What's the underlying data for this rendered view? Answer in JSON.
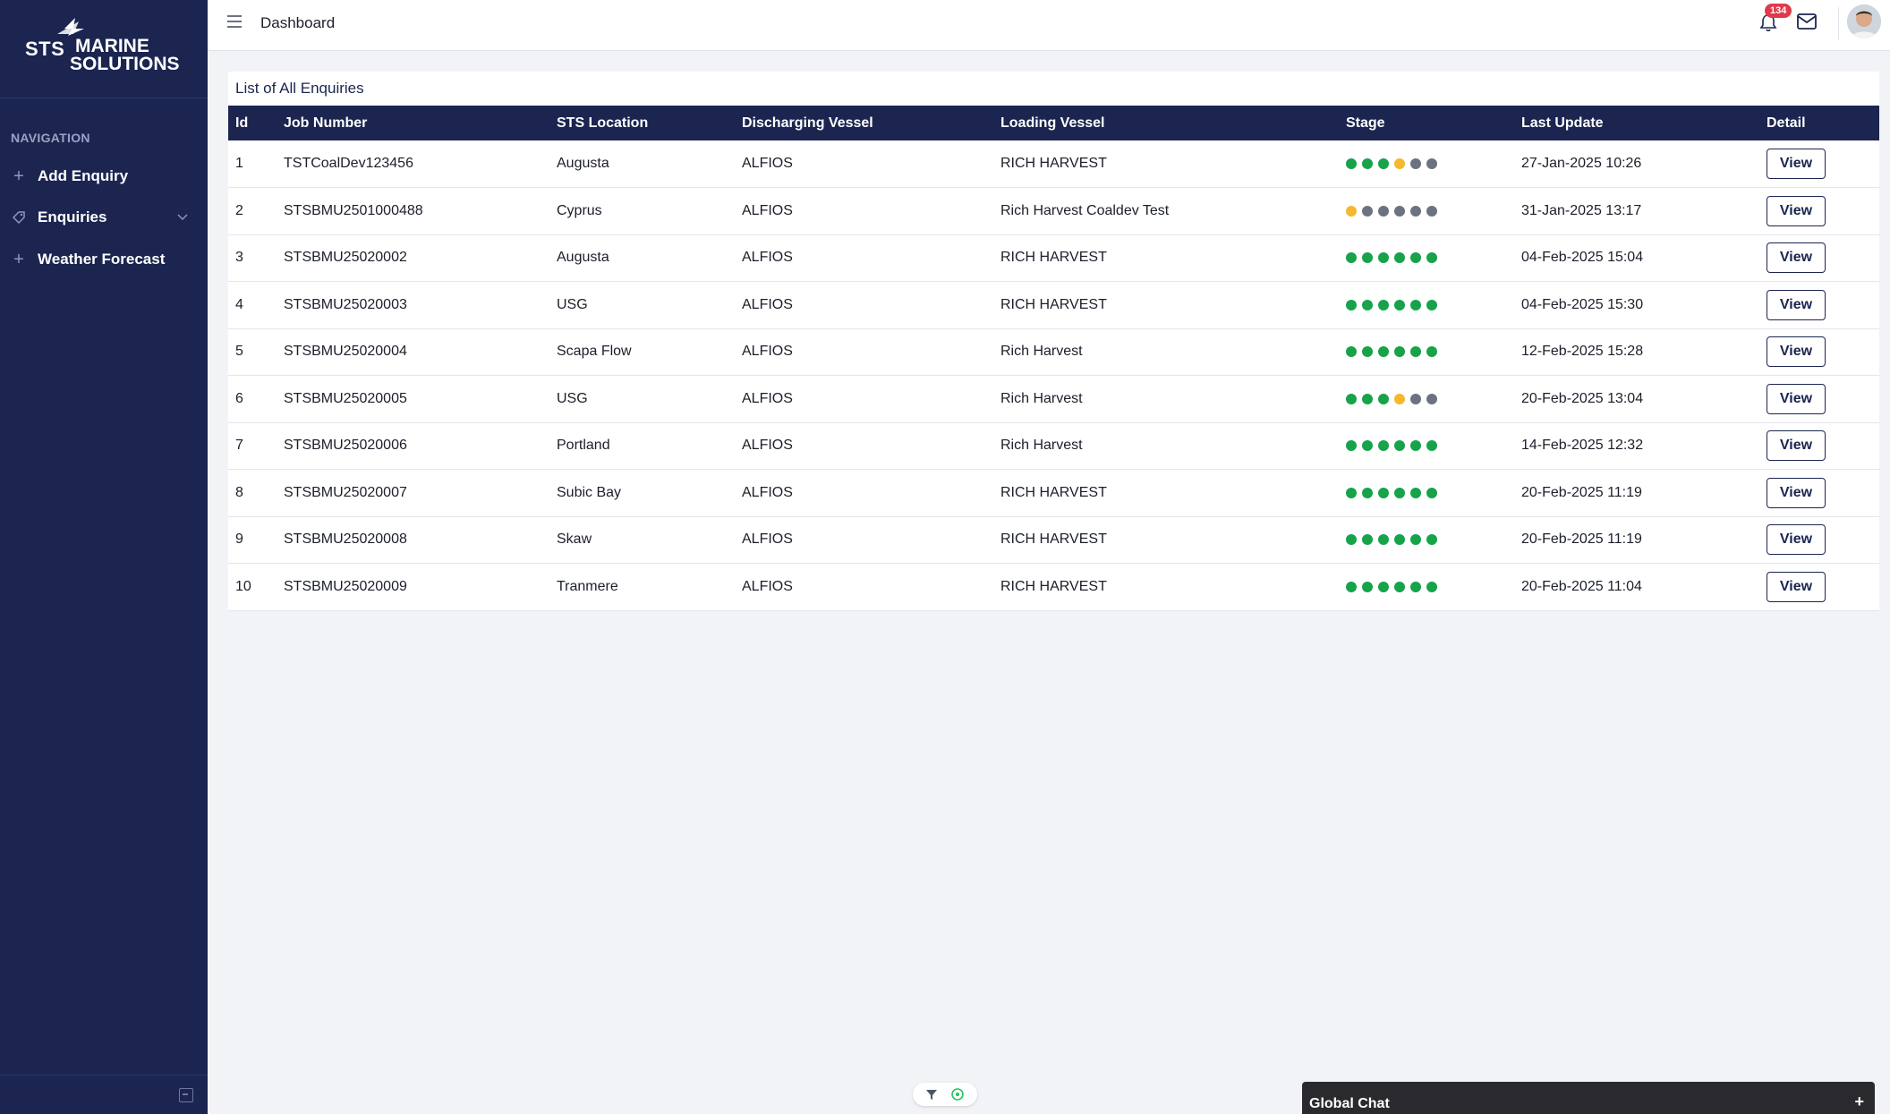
{
  "brand": {
    "line1": "STS",
    "line2": "MARINE",
    "line3": "SOLUTIONS"
  },
  "sidebar": {
    "heading": "NAVIGATION",
    "items": [
      {
        "label": "Add Enquiry",
        "icon": "plus-icon"
      },
      {
        "label": "Enquiries",
        "icon": "tag-icon",
        "expandable": true
      },
      {
        "label": "Weather Forecast",
        "icon": "plus-icon"
      }
    ]
  },
  "header": {
    "title": "Dashboard",
    "notification_count": "134"
  },
  "table": {
    "title": "List of All Enquiries",
    "columns": [
      "Id",
      "Job Number",
      "STS Location",
      "Discharging Vessel",
      "Loading Vessel",
      "Stage",
      "Last Update",
      "Detail"
    ],
    "view_label": "View",
    "stage_colors": {
      "done": "#16a34a",
      "current": "#f5b82e",
      "pending": "#6b7280"
    },
    "rows": [
      {
        "id": "1",
        "job": "TSTCoalDev123456",
        "location": "Augusta",
        "discharging": "ALFIOS",
        "loading": "RICH HARVEST",
        "stage": [
          "done",
          "done",
          "done",
          "current",
          "pending",
          "pending"
        ],
        "updated": "27-Jan-2025 10:26"
      },
      {
        "id": "2",
        "job": "STSBMU2501000488",
        "location": "Cyprus",
        "discharging": "ALFIOS",
        "loading": "Rich Harvest Coaldev Test",
        "stage": [
          "current",
          "pending",
          "pending",
          "pending",
          "pending",
          "pending"
        ],
        "updated": "31-Jan-2025 13:17"
      },
      {
        "id": "3",
        "job": "STSBMU25020002",
        "location": "Augusta",
        "discharging": "ALFIOS",
        "loading": "RICH HARVEST",
        "stage": [
          "done",
          "done",
          "done",
          "done",
          "done",
          "done"
        ],
        "updated": "04-Feb-2025 15:04"
      },
      {
        "id": "4",
        "job": "STSBMU25020003",
        "location": "USG",
        "discharging": "ALFIOS",
        "loading": "RICH HARVEST",
        "stage": [
          "done",
          "done",
          "done",
          "done",
          "done",
          "done"
        ],
        "updated": "04-Feb-2025 15:30"
      },
      {
        "id": "5",
        "job": "STSBMU25020004",
        "location": "Scapa Flow",
        "discharging": "ALFIOS",
        "loading": "Rich Harvest",
        "stage": [
          "done",
          "done",
          "done",
          "done",
          "done",
          "done"
        ],
        "updated": "12-Feb-2025 15:28"
      },
      {
        "id": "6",
        "job": "STSBMU25020005",
        "location": "USG",
        "discharging": "ALFIOS",
        "loading": "Rich Harvest",
        "stage": [
          "done",
          "done",
          "done",
          "current",
          "pending",
          "pending"
        ],
        "updated": "20-Feb-2025 13:04"
      },
      {
        "id": "7",
        "job": "STSBMU25020006",
        "location": "Portland",
        "discharging": "ALFIOS",
        "loading": "Rich Harvest",
        "stage": [
          "done",
          "done",
          "done",
          "done",
          "done",
          "done"
        ],
        "updated": "14-Feb-2025 12:32"
      },
      {
        "id": "8",
        "job": "STSBMU25020007",
        "location": "Subic Bay",
        "discharging": "ALFIOS",
        "loading": "RICH HARVEST",
        "stage": [
          "done",
          "done",
          "done",
          "done",
          "done",
          "done"
        ],
        "updated": "20-Feb-2025 11:19"
      },
      {
        "id": "9",
        "job": "STSBMU25020008",
        "location": "Skaw",
        "discharging": "ALFIOS",
        "loading": "RICH HARVEST",
        "stage": [
          "done",
          "done",
          "done",
          "done",
          "done",
          "done"
        ],
        "updated": "20-Feb-2025 11:19"
      },
      {
        "id": "10",
        "job": "STSBMU25020009",
        "location": "Tranmere",
        "discharging": "ALFIOS",
        "loading": "RICH HARVEST",
        "stage": [
          "done",
          "done",
          "done",
          "done",
          "done",
          "done"
        ],
        "updated": "20-Feb-2025 11:04"
      }
    ]
  },
  "chat": {
    "title": "Global Chat",
    "expand_label": "+"
  }
}
